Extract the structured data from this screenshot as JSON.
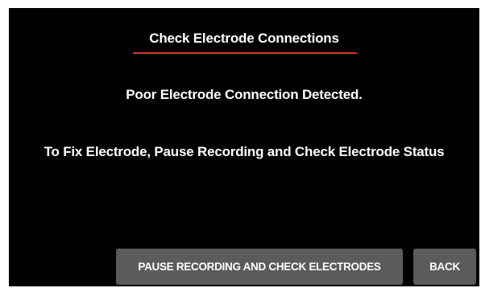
{
  "dialog": {
    "title": "Check Electrode Connections",
    "message": "Poor Electrode Connection Detected.",
    "instruction": "To Fix Electrode, Pause Recording and Check Electrode Status",
    "accent_color": "#d9342b"
  },
  "actions": {
    "pause_label": "PAUSE RECORDING AND CHECK ELECTRODES",
    "back_label": "BACK"
  }
}
